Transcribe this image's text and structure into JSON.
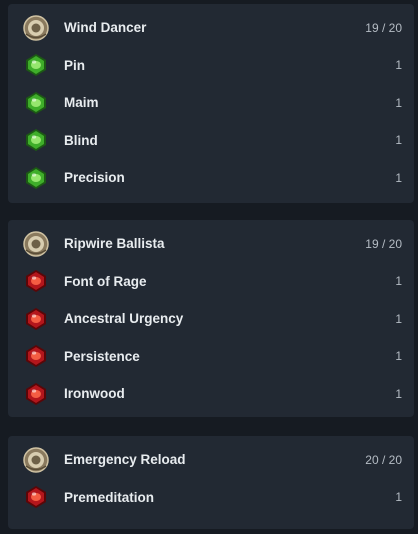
{
  "groups": [
    {
      "skills": [
        {
          "name": "Wind Dancer",
          "level": "19 / 20",
          "icon": "skill-gem-icon"
        },
        {
          "name": "Pin",
          "level": "1",
          "icon": "green-support-gem-icon"
        },
        {
          "name": "Maim",
          "level": "1",
          "icon": "green-support-gem-icon"
        },
        {
          "name": "Blind",
          "level": "1",
          "icon": "green-support-gem-icon"
        },
        {
          "name": "Precision",
          "level": "1",
          "icon": "green-support-gem-icon"
        }
      ]
    },
    {
      "skills": [
        {
          "name": "Ripwire Ballista",
          "level": "19 / 20",
          "icon": "skill-gem-icon"
        },
        {
          "name": "Font of Rage",
          "level": "1",
          "icon": "red-support-gem-icon"
        },
        {
          "name": "Ancestral Urgency",
          "level": "1",
          "icon": "red-support-gem-icon"
        },
        {
          "name": "Persistence",
          "level": "1",
          "icon": "red-support-gem-icon"
        },
        {
          "name": "Ironwood",
          "level": "1",
          "icon": "red-support-gem-icon"
        }
      ]
    },
    {
      "skills": [
        {
          "name": "Emergency Reload",
          "level": "20 / 20",
          "icon": "skill-gem-icon"
        },
        {
          "name": "Premeditation",
          "level": "1",
          "icon": "red-support-gem-icon"
        }
      ]
    }
  ],
  "colors": {
    "background": "#161b22",
    "panel": "#222933",
    "text": "#e8ecef",
    "level_text": "#b5bcc4",
    "green_gem": "#3fae2a",
    "red_gem": "#b3161c",
    "skill_gem": "#b9a98a"
  }
}
